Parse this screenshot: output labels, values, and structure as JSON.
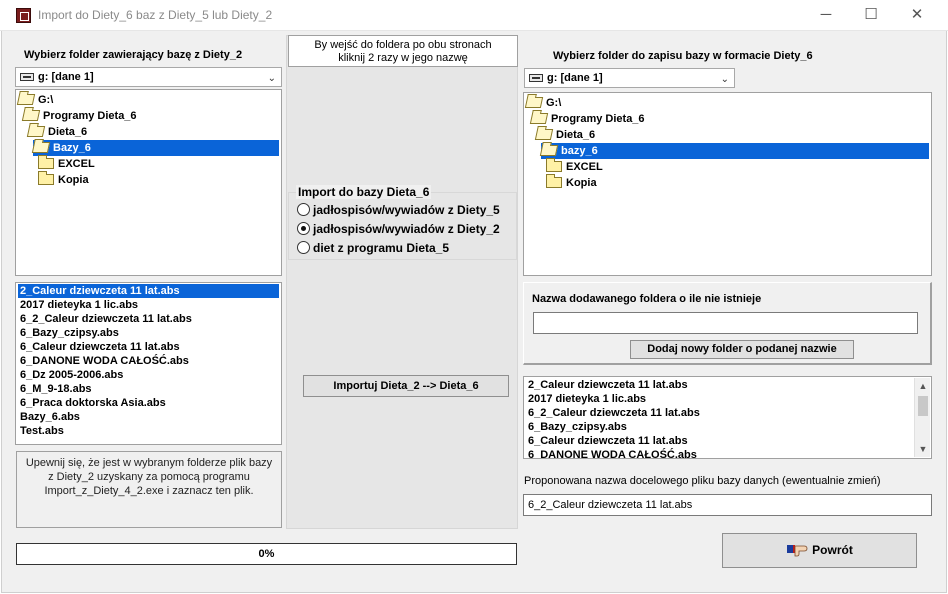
{
  "window": {
    "title": "Import do Diety_6 baz z Diety_5 lub Diety_2",
    "minimize": "─",
    "maximize": "☐",
    "close": "✕"
  },
  "left": {
    "heading": "Wybierz folder zawierający bazę z Diety_2",
    "drive": "g: [dane 1]",
    "tree": [
      {
        "label": "G:\\",
        "level": 0,
        "icon": "folder-open-icon",
        "selected": false
      },
      {
        "label": "Programy Dieta_6",
        "level": 1,
        "icon": "folder-open-icon",
        "selected": false
      },
      {
        "label": "Dieta_6",
        "level": 2,
        "icon": "folder-open-icon",
        "selected": false
      },
      {
        "label": "Bazy_6",
        "level": 3,
        "icon": "folder-open-icon",
        "selected": true
      },
      {
        "label": "EXCEL",
        "level": 4,
        "icon": "folder-closed-icon",
        "selected": false
      },
      {
        "label": "Kopia",
        "level": 4,
        "icon": "folder-closed-icon",
        "selected": false
      }
    ],
    "files": [
      "2_Caleur dziewczeta 11 lat.abs",
      "2017 dieteyka 1 lic.abs",
      "6_2_Caleur dziewczeta 11 lat.abs",
      "6_Bazy_czipsy.abs",
      "6_Caleur dziewczeta 11 lat.abs",
      "6_DANONE WODA CAŁOŚĆ.abs",
      "6_Dz 2005-2006.abs",
      "6_M_9-18.abs",
      "6_Praca doktorska Asia.abs",
      "Bazy_6.abs",
      "Test.abs"
    ],
    "selected_file_index": 0,
    "note": "Upewnij się, że jest w wybranym folderze plik bazy z Diety_2 uzyskany za pomocą programu Import_z_Diety_4_2.exe i zaznacz ten plik.",
    "progress": "0%"
  },
  "center": {
    "hint_line1": "By wejść do foldera po obu stronach",
    "hint_line2": "kliknij 2 razy w jego nazwę",
    "group_title": "Import do bazy Dieta_6",
    "options": [
      {
        "label": "jadłospisów/wywiadów z Diety_5",
        "checked": false
      },
      {
        "label": "jadłospisów/wywiadów z Diety_2",
        "checked": true
      },
      {
        "label": "diet z programu Dieta_5",
        "checked": false
      }
    ],
    "import_button": "Importuj Dieta_2 --> Dieta_6"
  },
  "right": {
    "heading": "Wybierz folder do zapisu  bazy w formacie Diety_6",
    "drive": "g: [dane 1]",
    "tree": [
      {
        "label": "G:\\",
        "level": 0,
        "icon": "folder-open-icon",
        "selected": false
      },
      {
        "label": "Programy Dieta_6",
        "level": 1,
        "icon": "folder-open-icon",
        "selected": false
      },
      {
        "label": "Dieta_6",
        "level": 2,
        "icon": "folder-open-icon",
        "selected": false
      },
      {
        "label": "bazy_6",
        "level": 3,
        "icon": "folder-open-icon",
        "selected": true
      },
      {
        "label": "EXCEL",
        "level": 4,
        "icon": "folder-closed-icon",
        "selected": false
      },
      {
        "label": "Kopia",
        "level": 4,
        "icon": "folder-closed-icon",
        "selected": false
      }
    ],
    "new_folder_label": "Nazwa dodawanego foldera o ile nie istnieje",
    "new_folder_value": "",
    "add_folder_button": "Dodaj nowy folder o podanej nazwie",
    "files": [
      "2_Caleur dziewczeta 11 lat.abs",
      "2017 dieteyka 1 lic.abs",
      "6_2_Caleur dziewczeta 11 lat.abs",
      "6_Bazy_czipsy.abs",
      "6_Caleur dziewczeta 11 lat.abs",
      "6_DANONE WODA CAŁOŚĆ.abs"
    ],
    "target_label": "Proponowana nazwa docelowego pliku bazy danych (ewentualnie zmień)",
    "target_value": "6_2_Caleur dziewczeta 11 lat.abs",
    "back_button": "Powrót",
    "back_icon": "hand-back-icon"
  },
  "colors": {
    "selection": "#0a64d8",
    "background": "#f0f0f0"
  }
}
